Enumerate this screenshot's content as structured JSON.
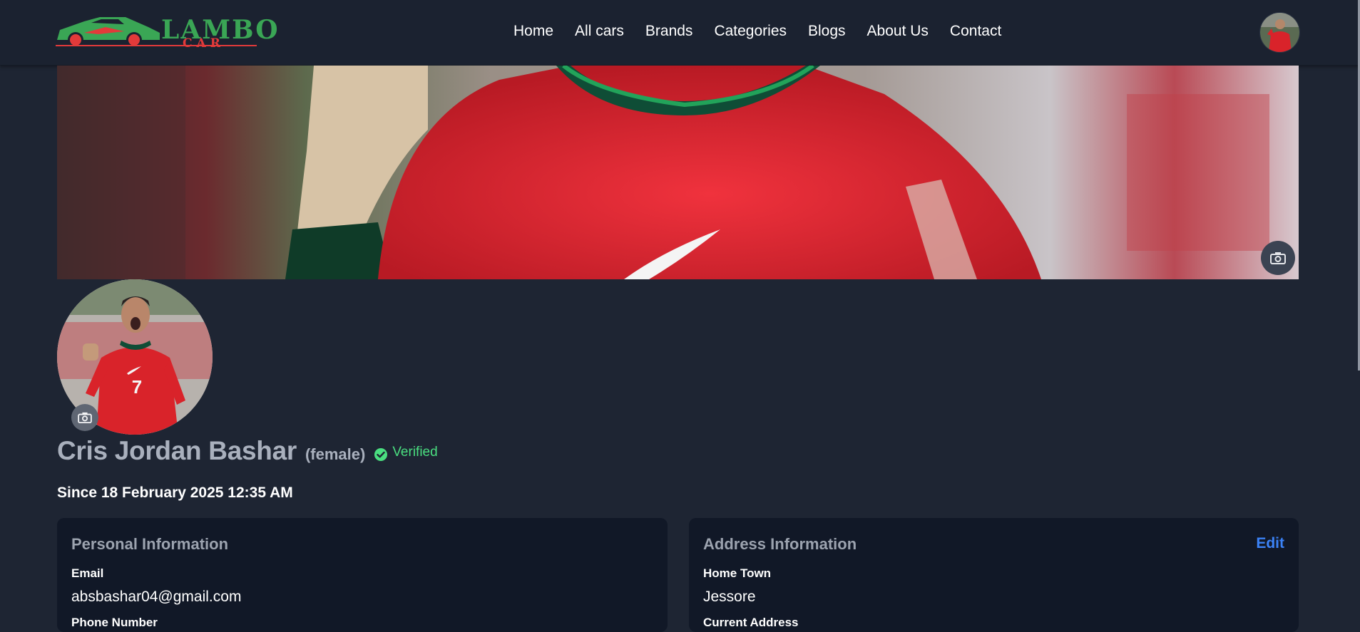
{
  "brand": {
    "name": "LAMBO",
    "sub": "CAR",
    "green": "#3aa655",
    "red": "#e23a3a"
  },
  "nav": {
    "links": [
      "Home",
      "All cars",
      "Brands",
      "Categories",
      "Blogs",
      "About Us",
      "Contact"
    ]
  },
  "icons": {
    "camera": "camera-icon",
    "verified": "check-circle-icon"
  },
  "profile": {
    "name": "Cris Jordan Bashar",
    "gender": "(female)",
    "verified_label": "Verified",
    "since": "Since 18 February 2025 12:35 AM"
  },
  "personal": {
    "title": "Personal Information",
    "email_label": "Email",
    "email_value": "absbashar04@gmail.com",
    "phone_label": "Phone Number"
  },
  "address": {
    "title": "Address Information",
    "edit_label": "Edit",
    "hometown_label": "Home Town",
    "hometown_value": "Jessore",
    "current_label": "Current Address"
  },
  "colors": {
    "background": "#1e2533",
    "card": "#111827",
    "verified": "#4ade80",
    "link": "#3b82f6"
  }
}
